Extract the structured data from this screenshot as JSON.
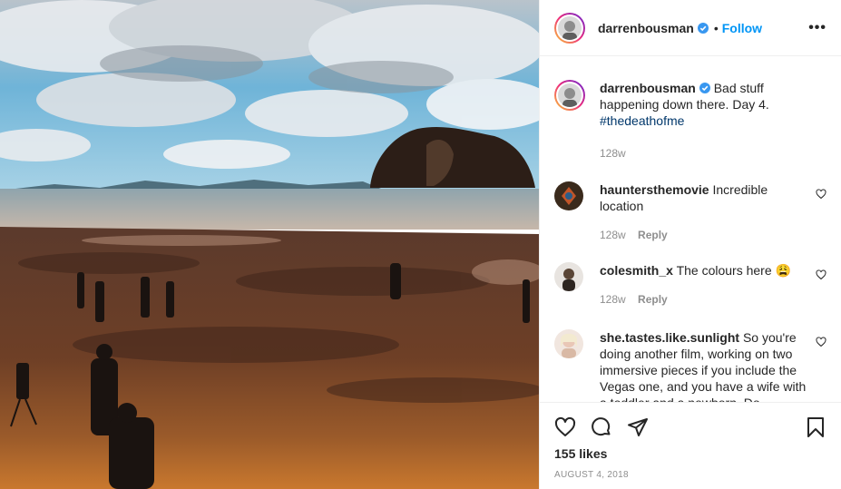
{
  "post": {
    "author": "darrenbousman",
    "follow_label": "Follow",
    "separator": "•",
    "more_label": "•••"
  },
  "caption": {
    "username": "darrenbousman",
    "text": "Bad stuff happening down there. Day 4. ",
    "hashtag": "#thedeathofme",
    "time": "128w"
  },
  "comments": [
    {
      "username": "hauntersthemovie",
      "text": "Incredible location",
      "time": "128w",
      "reply_label": "Reply"
    },
    {
      "username": "colesmith_x",
      "text": "The colours here 😩",
      "time": "128w",
      "reply_label": "Reply"
    },
    {
      "username": "she.tastes.like.sunlight",
      "text": "So you're doing another film, working on two immersive pieces if you include the Vegas one, and you have a wife with a toddler and a newborn. Do"
    }
  ],
  "footer": {
    "likes": "155 likes",
    "date": "AUGUST 4, 2018"
  },
  "colors": {
    "link_blue": "#0095f6",
    "hashtag_blue": "#00376b",
    "muted": "#8e8e8e"
  }
}
